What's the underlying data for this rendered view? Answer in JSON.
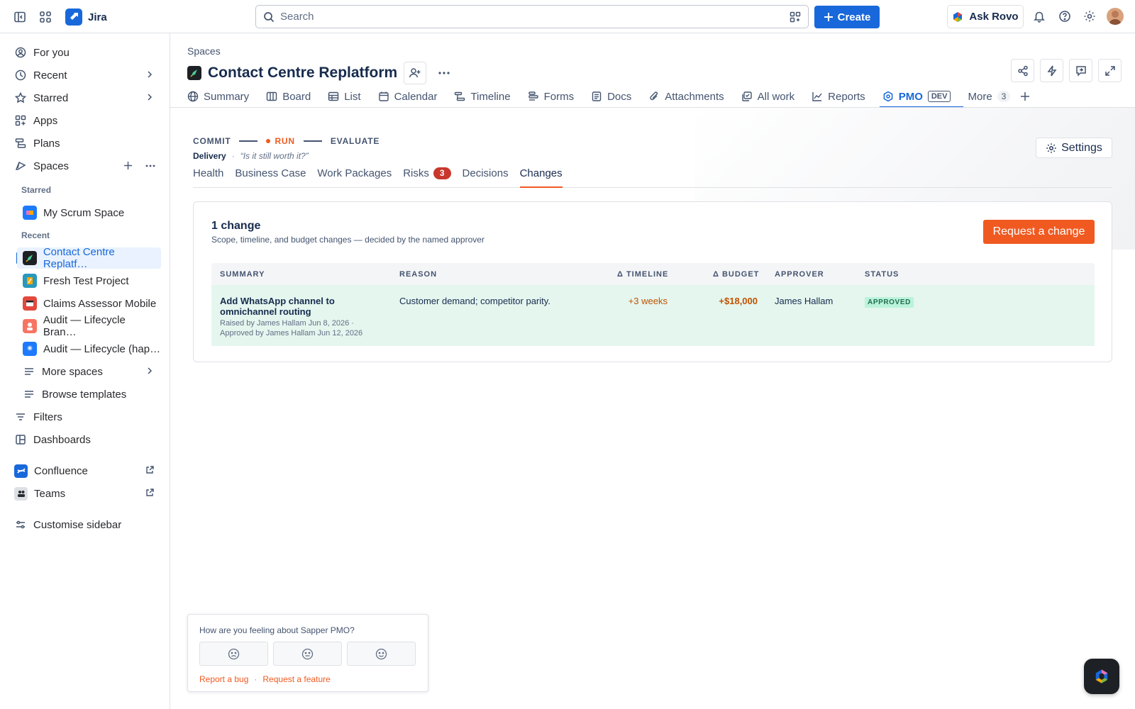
{
  "topbar": {
    "app_name": "Jira",
    "search_placeholder": "Search",
    "create_label": "Create",
    "ask_rovo_label": "Ask Rovo"
  },
  "sidebar": {
    "items": [
      {
        "label": "For you",
        "icon": "user-circle-icon"
      },
      {
        "label": "Recent",
        "icon": "clock-icon"
      },
      {
        "label": "Starred",
        "icon": "star-icon"
      },
      {
        "label": "Apps",
        "icon": "apps-icon"
      },
      {
        "label": "Plans",
        "icon": "plans-icon"
      },
      {
        "label": "Spaces",
        "icon": "spaces-icon"
      }
    ],
    "starred_header": "Starred",
    "starred_spaces": [
      {
        "label": "My Scrum Space",
        "color": "#1d7afc"
      }
    ],
    "recent_header": "Recent",
    "recent_spaces": [
      {
        "label": "Contact Centre Replatf…",
        "color": "#1d2125",
        "active": true
      },
      {
        "label": "Fresh Test Project",
        "color": "#2898bd"
      },
      {
        "label": "Claims Assessor Mobile",
        "color": "#e2483d"
      },
      {
        "label": "Audit — Lifecycle Bran…",
        "color": "#f87462"
      },
      {
        "label": "Audit — Lifecycle (hap…",
        "color": "#1d7afc"
      }
    ],
    "more_spaces": "More spaces",
    "browse_templates": "Browse templates",
    "filters": "Filters",
    "dashboards": "Dashboards",
    "confluence": "Confluence",
    "teams": "Teams",
    "customise": "Customise sidebar"
  },
  "page": {
    "breadcrumb": "Spaces",
    "title": "Contact Centre Replatform",
    "tabs": [
      {
        "label": "Summary",
        "icon": "globe-icon"
      },
      {
        "label": "Board",
        "icon": "board-icon"
      },
      {
        "label": "List",
        "icon": "list-icon"
      },
      {
        "label": "Calendar",
        "icon": "calendar-icon"
      },
      {
        "label": "Timeline",
        "icon": "timeline-icon"
      },
      {
        "label": "Forms",
        "icon": "forms-icon"
      },
      {
        "label": "Docs",
        "icon": "docs-icon"
      },
      {
        "label": "Attachments",
        "icon": "paperclip-icon"
      },
      {
        "label": "All work",
        "icon": "all-work-icon"
      },
      {
        "label": "Reports",
        "icon": "chart-line-icon"
      },
      {
        "label": "PMO",
        "icon": "hexagon-icon",
        "badge": "DEV",
        "active": true
      }
    ],
    "more_label": "More",
    "more_count": "3"
  },
  "pmo": {
    "stages": {
      "commit": "COMMIT",
      "run": "RUN",
      "evaluate": "EVALUATE"
    },
    "phase_label": "Delivery",
    "phase_quote": "“Is it still worth it?”",
    "settings_label": "Settings",
    "subtabs": [
      {
        "label": "Health"
      },
      {
        "label": "Business Case"
      },
      {
        "label": "Work Packages"
      },
      {
        "label": "Risks",
        "badge": "3"
      },
      {
        "label": "Decisions"
      },
      {
        "label": "Changes",
        "active": true
      }
    ]
  },
  "changes": {
    "title": "1 change",
    "subtitle": "Scope, timeline, and budget changes — decided by the named approver",
    "request_label": "Request a change",
    "columns": {
      "summary": "SUMMARY",
      "reason": "REASON",
      "timeline": "Δ TIMELINE",
      "budget": "Δ BUDGET",
      "approver": "APPROVER",
      "status": "STATUS"
    },
    "rows": [
      {
        "summary": "Add WhatsApp channel to omnichannel routing",
        "raised": "Raised by James Hallam Jun 8, 2026 ·",
        "approved_by": "Approved by James Hallam Jun 12, 2026",
        "reason": "Customer demand; competitor parity.",
        "timeline": "+3 weeks",
        "budget": "+$18,000",
        "approver": "James Hallam",
        "status": "APPROVED"
      }
    ]
  },
  "feedback": {
    "question": "How are you feeling about Sapper PMO?",
    "report_bug": "Report a bug",
    "sep": "·",
    "request_feature": "Request a feature"
  },
  "colors": {
    "brand_blue": "#1868db",
    "accent_orange": "#f05a21",
    "approved_green": "#216e4e",
    "risk_red": "#c9372c"
  }
}
